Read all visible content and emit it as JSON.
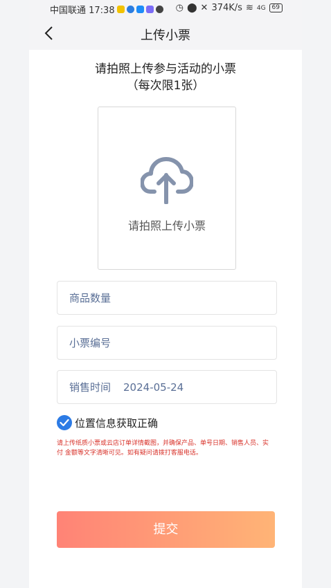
{
  "status_bar": {
    "carrier_time": "中国联通 17:38",
    "speed": "374K/s",
    "network": "4G",
    "battery": "69"
  },
  "header": {
    "title": "上传小票"
  },
  "intro": {
    "line1": "请拍照上传参与活动的小票",
    "line2": "（每次限1张）"
  },
  "upload": {
    "label": "请拍照上传小票",
    "icon": "cloud-upload-icon"
  },
  "fields": {
    "quantity": {
      "label": "商品数量"
    },
    "receipt_no": {
      "label": "小票编号"
    },
    "sale_time": {
      "label": "销售时间",
      "value": "2024-05-24"
    }
  },
  "location_check": {
    "checked": true,
    "label": "位置信息获取正确"
  },
  "note": "请上传纸质小票或云店订单详情截图，并确保产品、单号日期、销售人员、实付 金额等文字清晰可见。如有疑问请拨打客服电话。",
  "submit_label": "提交",
  "colors": {
    "accent_blue": "#2c7be5",
    "note_red": "#d8322a",
    "button_gradient_start": "#ff8376",
    "button_gradient_end": "#ffb476",
    "icon_gray": "#8593ac"
  }
}
